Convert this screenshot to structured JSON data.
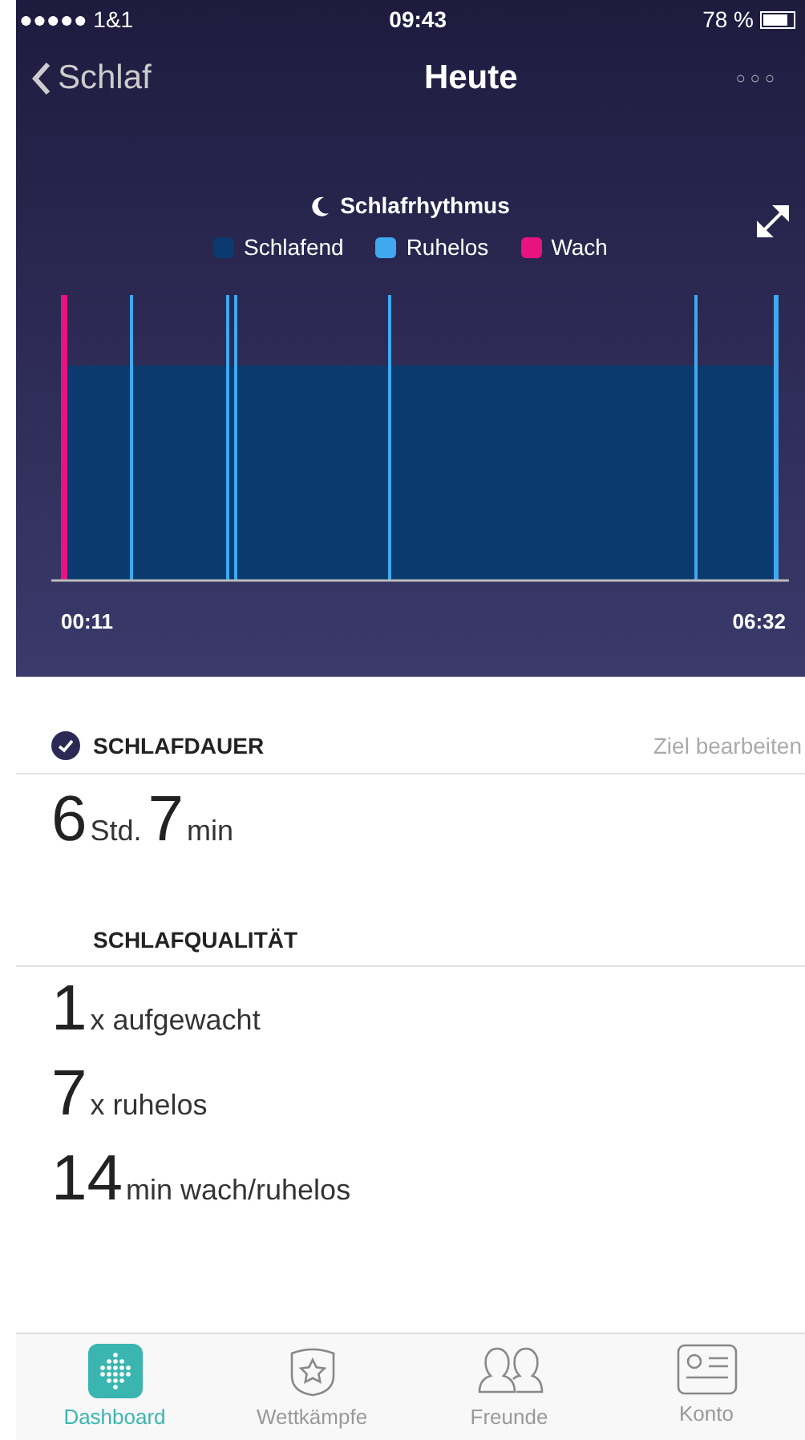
{
  "status_bar": {
    "carrier": "●●●●● 1&1",
    "time": "09:43",
    "battery": "78 %"
  },
  "nav": {
    "back": "Schlaf",
    "title": "Heute",
    "more": "○○○"
  },
  "chart": {
    "title": "Schlafrhythmus",
    "legend": [
      {
        "label": "Schlafend",
        "color": "#0b3a6e"
      },
      {
        "label": "Ruhelos",
        "color": "#3fa9f0"
      },
      {
        "label": "Wach",
        "color": "#e8137e"
      }
    ],
    "start": "00:11",
    "end": "06:32"
  },
  "duration": {
    "heading": "SCHLAFDAUER",
    "done": true,
    "action": "Ziel bearbeiten",
    "hours": "6",
    "hours_unit": "Std.",
    "minutes": "7",
    "minutes_unit": "min"
  },
  "quality": {
    "heading": "SCHLAFQUALITÄT",
    "rows": [
      {
        "value": "1",
        "text": "x aufgewacht"
      },
      {
        "value": "7",
        "text": "x ruhelos"
      },
      {
        "value": "14",
        "text": "min wach/ruhelos"
      }
    ]
  },
  "tabs": [
    {
      "label": "Dashboard",
      "kind": "dashboard",
      "selected": true
    },
    {
      "label": "Wettkämpfe",
      "kind": "challenges",
      "selected": false
    },
    {
      "label": "Freunde",
      "kind": "friends",
      "selected": false
    },
    {
      "label": "Konto",
      "kind": "account",
      "selected": false
    }
  ]
}
